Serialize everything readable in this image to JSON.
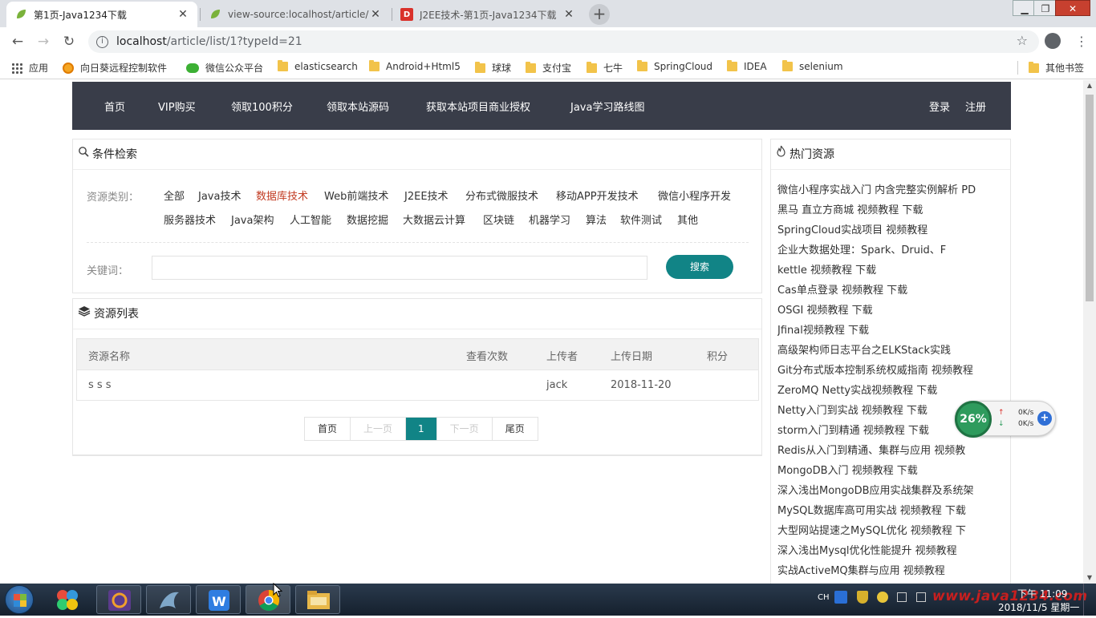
{
  "browser": {
    "tabs": [
      {
        "title": "第1页-Java1234下载",
        "active": true
      },
      {
        "title": "view-source:localhost/article/l",
        "active": false
      },
      {
        "title": "J2EE技术-第1页-Java1234下载",
        "active": false
      }
    ],
    "url_host": "localhost",
    "url_path": "/article/list/1?typeId=21",
    "bookmarks": [
      {
        "label": "应用",
        "icon": "apps-grid-icon"
      },
      {
        "label": "向日葵远程控制软件",
        "icon": "sunflower-icon"
      },
      {
        "label": "微信公众平台",
        "icon": "wechat-icon"
      },
      {
        "label": "elasticsearch",
        "icon": "folder-icon"
      },
      {
        "label": "Android+Html5",
        "icon": "folder-icon"
      },
      {
        "label": "球球",
        "icon": "folder-icon"
      },
      {
        "label": "支付宝",
        "icon": "folder-icon"
      },
      {
        "label": "七牛",
        "icon": "folder-icon"
      },
      {
        "label": "SpringCloud",
        "icon": "folder-icon"
      },
      {
        "label": "IDEA",
        "icon": "folder-icon"
      },
      {
        "label": "selenium",
        "icon": "folder-icon"
      },
      {
        "label": "其他书签",
        "icon": "folder-icon"
      }
    ]
  },
  "nav": {
    "items": [
      "首页",
      "VIP购买",
      "领取100积分",
      "领取本站源码",
      "获取本站项目商业授权",
      "Java学习路线图"
    ],
    "login": "登录",
    "register": "注册"
  },
  "filter": {
    "title": "条件检索",
    "category_label": "资源类别：",
    "categories": [
      "全部",
      "Java技术",
      "数据库技术",
      "Web前端技术",
      "J2EE技术",
      "分布式微服技术",
      "移动APP开发技术",
      "微信小程序开发",
      "服务器技术",
      "Java架构",
      "人工智能",
      "数据挖掘",
      "大数据云计算",
      "区块链",
      "机器学习",
      "算法",
      "软件测试",
      "其他"
    ],
    "active_category": "数据库技术",
    "keyword_label": "关键词：",
    "keyword_value": "",
    "search_button": "搜索"
  },
  "resources": {
    "title": "资源列表",
    "columns": [
      "资源名称",
      "查看次数",
      "上传者",
      "上传日期",
      "积分"
    ],
    "rows": [
      {
        "name": "s s s",
        "views": "",
        "uploader": "jack",
        "date": "2018-11-20",
        "points": ""
      }
    ],
    "pager": [
      "首页",
      "上一页",
      "1",
      "下一页",
      "尾页"
    ]
  },
  "hot": {
    "title": "热门资源",
    "items": [
      "微信小程序实战入门 内含完整实例解析 PD",
      "黑马 直立方商城 视频教程 下载",
      "SpringCloud实战项目 视频教程",
      "企业大数据处理：Spark、Druid、F",
      "kettle 视频教程 下载",
      "Cas单点登录 视频教程 下载",
      "OSGI 视频教程 下载",
      "Jfinal视频教程 下载",
      "高级架构师日志平台之ELKStack实践",
      "Git分布式版本控制系统权威指南 视频教程",
      "ZeroMQ Netty实战视频教程 下载",
      "Netty入门到实战 视频教程 下载",
      "storm入门到精通 视频教程 下载",
      "Redis从入门到精通、集群与应用 视频教",
      "MongoDB入门 视频教程 下载",
      "深入浅出MongoDB应用实战集群及系统架",
      "MySQL数据库高可用实战 视频教程 下载",
      "大型网站提速之MySQL优化 视频教程 下",
      "深入浅出Mysql优化性能提升 视频教程",
      "实战ActiveMQ集群与应用 视频教程"
    ]
  },
  "net_widget": {
    "percent": "26%",
    "up": "0K/s",
    "down": "0K/s"
  },
  "taskbar": {
    "time": "下午 11:09",
    "date": "2018/11/5 星期一",
    "ime": "CH",
    "watermark": "www.java1234.com"
  },
  "colors": {
    "navbar": "#393d49",
    "accent": "#118486",
    "active_category": "#c23b22"
  }
}
